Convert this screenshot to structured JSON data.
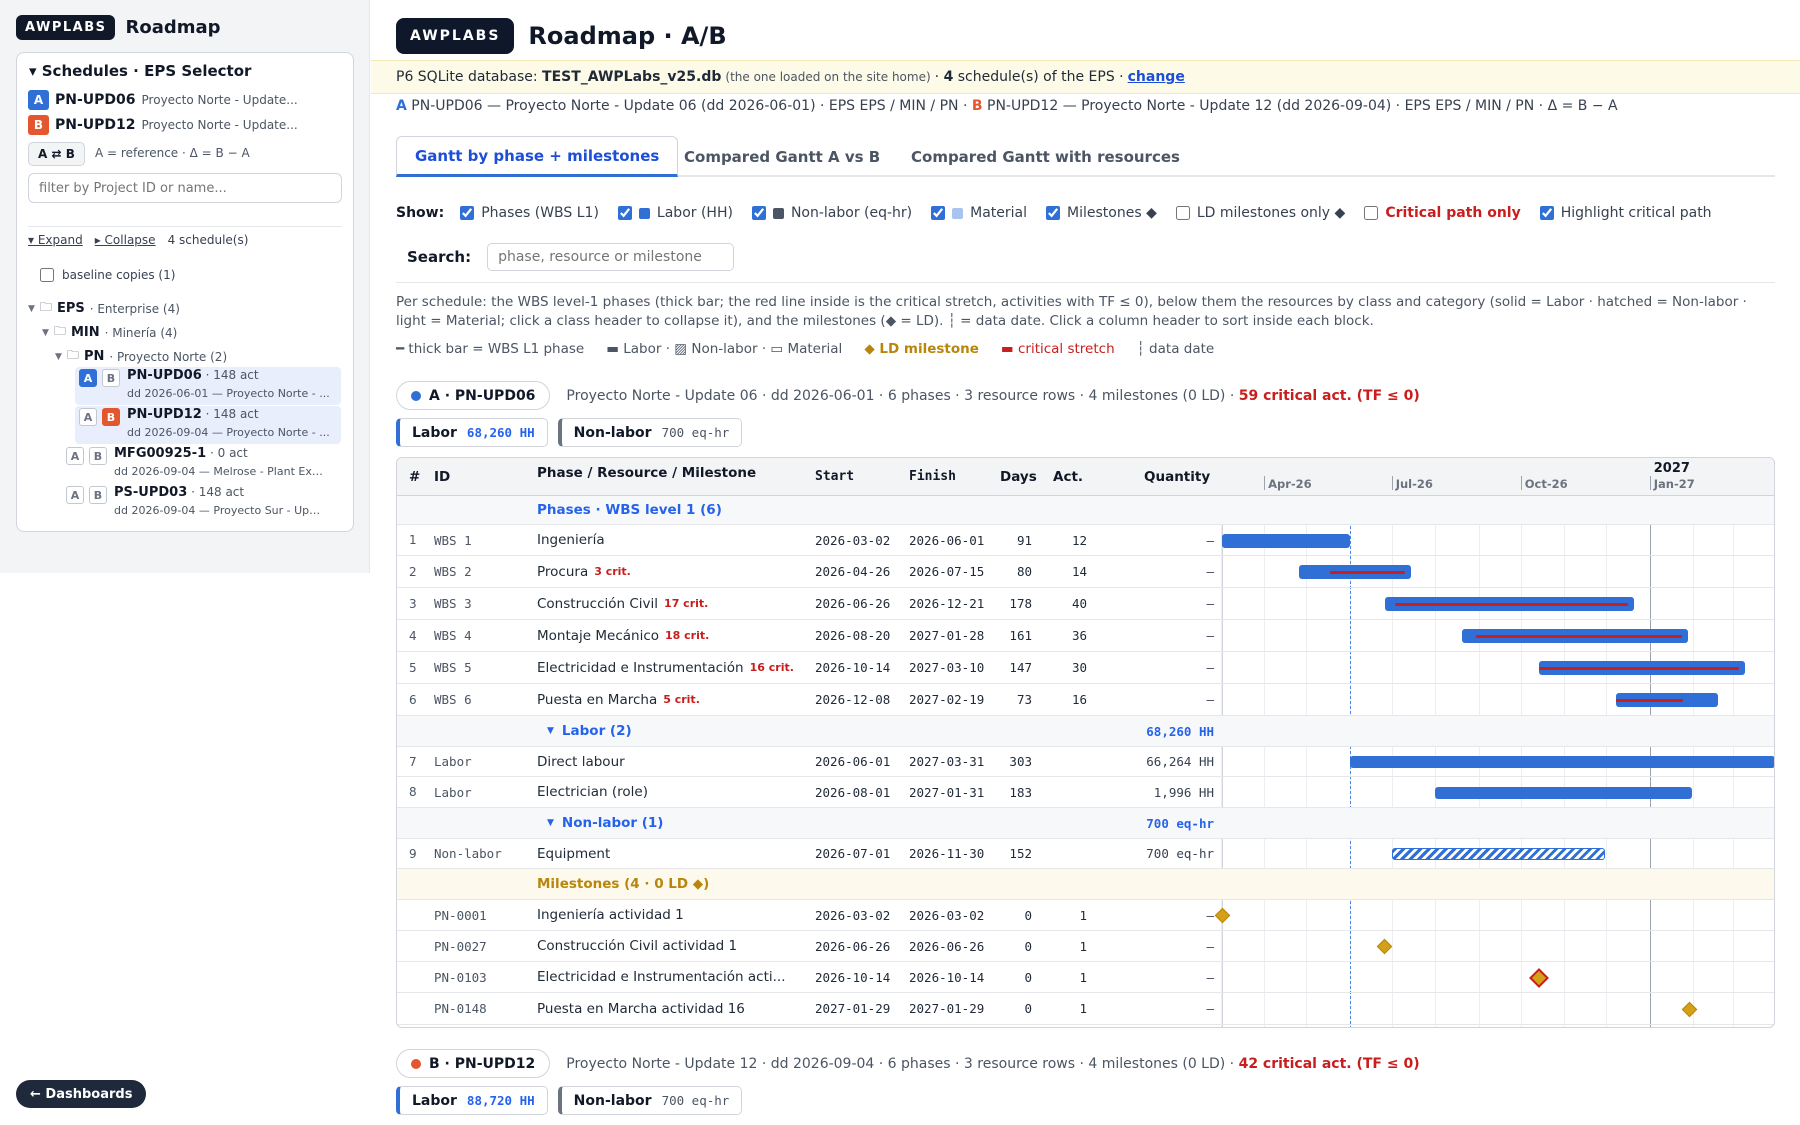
{
  "sidebar": {
    "brand_logo": "AWPLABS",
    "brand_title": "Roadmap",
    "panel_title": "▾ Schedules · EPS Selector",
    "schedule_a": {
      "badge": "A",
      "id": "PN-UPD06",
      "name": "Proyecto Norte - Update..."
    },
    "schedule_b": {
      "badge": "B",
      "id": "PN-UPD12",
      "name": "Proyecto Norte - Update..."
    },
    "swap_label": "A ⇄ B",
    "swap_note": "A = reference · Δ = B − A",
    "filter_placeholder": "filter by Project ID or name...",
    "expand_label": "▾ Expand",
    "collapse_label": "▸ Collapse",
    "schedule_count": "4 schedule(s)",
    "baseline_label": "baseline copies (1)",
    "tree": {
      "eps": {
        "name": "EPS",
        "desc": "· Enterprise (4)"
      },
      "min": {
        "name": "MIN",
        "desc": "· Minería (4)"
      },
      "pn": {
        "name": "PN",
        "desc": "· Proyecto Norte (2)"
      }
    },
    "leaves": [
      {
        "id": "PN-UPD06",
        "acts": "· 148 act",
        "sub": "dd 2026-06-01 — Proyecto Norte - ...",
        "a_label": "A",
        "b_label": "B"
      },
      {
        "id": "PN-UPD12",
        "acts": "· 148 act",
        "sub": "dd 2026-09-04 — Proyecto Norte - ...",
        "a_label": "A",
        "b_label": "B"
      },
      {
        "id": "MFG00925-1",
        "acts": "· 0 act",
        "sub": "dd 2026-09-04 — Melrose - Plant Expa...",
        "a_label": "A",
        "b_label": "B"
      },
      {
        "id": "PS-UPD03",
        "acts": "· 148 act",
        "sub": "dd 2026-09-04 — Proyecto Sur - Upda...",
        "a_label": "A",
        "b_label": "B"
      }
    ],
    "dashboards_label": "← Dashboards"
  },
  "header": {
    "logo": "AWPLABS",
    "title": "Roadmap · A/B"
  },
  "banner": {
    "prefix": "P6 SQLite database:",
    "db_name": "TEST_AWPLabs_v25.db",
    "note": "(the one loaded on the site home)",
    "count_pre": "·",
    "count": "4",
    "count_post": "schedule(s) of the EPS ·",
    "change_label": "change"
  },
  "ab_line": {
    "a_tag": "A",
    "a_text": "PN-UPD06 — Proyecto Norte - Update 06 (dd 2026-06-01) · EPS EPS / MIN / PN ·",
    "b_tag": "B",
    "b_text": "PN-UPD12 — Proyecto Norte - Update 12 (dd 2026-09-04) · EPS EPS / MIN / PN · Δ = B − A"
  },
  "tabs": [
    {
      "label": "Gantt by phase + milestones"
    },
    {
      "label": "Compared Gantt A vs B"
    },
    {
      "label": "Compared Gantt with resources"
    }
  ],
  "show": {
    "label": "Show:",
    "options": [
      {
        "label": "Phases (WBS L1)",
        "checked": true
      },
      {
        "label": "Labor (HH)",
        "checked": true
      },
      {
        "label": "Non-labor (eq-hr)",
        "checked": true
      },
      {
        "label": "Material",
        "checked": true
      },
      {
        "label": "Milestones ◆",
        "checked": true
      },
      {
        "label": "LD milestones only ◆",
        "checked": false
      },
      {
        "label": "Critical path only",
        "checked": false
      },
      {
        "label": "Highlight critical path",
        "checked": true
      }
    ]
  },
  "search": {
    "label": "Search:",
    "placeholder": "phase, resource or milestone"
  },
  "description": "Per schedule: the WBS level-1 phases (thick bar; the red line inside is the critical stretch, activities with TF ≤ 0), below them the resources by class and category (solid = Labor · hatched = Non-labor · light = Material; click a class header to collapse it), and the milestones (◆ = LD). ┆ = data date. Click a column header to sort inside each block.",
  "legend": {
    "phase": "━ thick bar = WBS L1 phase",
    "labor": "▬ Labor · ▨ Non-labor · ▭ Material",
    "ld": "◆ LD milestone",
    "crit": "▬ critical stretch",
    "dd": "┆ data date"
  },
  "schedule_a_block": {
    "pill": "A · PN-UPD06",
    "summary": "Proyecto Norte - Update 06 · dd 2026-06-01 · 6 phases · 3 resource rows · 4 milestones (0 LD) ·",
    "critical": "59 critical act. (TF ≤ 0)",
    "labor_card": {
      "label": "Labor",
      "value": "68,260 HH"
    },
    "nonlabor_card": {
      "label": "Non-labor",
      "value": "700 eq-hr"
    }
  },
  "schedule_b_block": {
    "pill": "B · PN-UPD12",
    "summary": "Proyecto Norte - Update 12 · dd 2026-09-04 · 6 phases · 3 resource rows · 4 milestones (0 LD) ·",
    "critical": "42 critical act. (TF ≤ 0)",
    "labor_card": {
      "label": "Labor",
      "value": "88,720 HH"
    },
    "nonlabor_card": {
      "label": "Non-labor",
      "value": "700 eq-hr"
    }
  },
  "grid": {
    "columns": {
      "num": "#",
      "id": "ID",
      "name": "Phase / Resource / Milestone",
      "start": "Start",
      "finish": "Finish",
      "days": "Days",
      "act": "Act.",
      "qty": "Quantity"
    },
    "timeline": {
      "year_label": "2027",
      "months": [
        "Apr-26",
        "Jul-26",
        "Oct-26",
        "Jan-27"
      ],
      "data_date": "2026-06-01",
      "range_start": "2026-03-02",
      "range_end": "2027-04-01"
    },
    "phases_header": "Phases · WBS level 1 (6)",
    "phases": [
      {
        "num": "1",
        "id": "WBS 1",
        "name": "Ingeniería",
        "crit": "",
        "start": "2026-03-02",
        "finish": "2026-06-01",
        "days": "91",
        "act": "12",
        "qty": "–",
        "crit_start": "",
        "crit_end": ""
      },
      {
        "num": "2",
        "id": "WBS 2",
        "name": "Procura",
        "crit": "3 crit.",
        "start": "2026-04-26",
        "finish": "2026-07-15",
        "days": "80",
        "act": "14",
        "qty": "–",
        "crit_start": "2026-05-18",
        "crit_end": "2026-07-15"
      },
      {
        "num": "3",
        "id": "WBS 3",
        "name": "Construcción Civil",
        "crit": "17 crit.",
        "start": "2026-06-26",
        "finish": "2026-12-21",
        "days": "178",
        "act": "40",
        "qty": "–",
        "crit_start": "2026-07-03",
        "crit_end": "2026-12-21"
      },
      {
        "num": "4",
        "id": "WBS 4",
        "name": "Montaje Mecánico",
        "crit": "18 crit.",
        "start": "2026-08-20",
        "finish": "2027-01-28",
        "days": "161",
        "act": "36",
        "qty": "–",
        "crit_start": "2026-08-30",
        "crit_end": "2027-01-28"
      },
      {
        "num": "5",
        "id": "WBS 5",
        "name": "Electricidad e Instrumentación",
        "crit": "16 crit.",
        "start": "2026-10-14",
        "finish": "2027-03-10",
        "days": "147",
        "act": "30",
        "qty": "–",
        "crit_start": "2026-10-14",
        "crit_end": "2027-03-10"
      },
      {
        "num": "6",
        "id": "WBS 6",
        "name": "Puesta en Marcha",
        "crit": "5 crit.",
        "start": "2026-12-08",
        "finish": "2027-02-19",
        "days": "73",
        "act": "16",
        "qty": "–",
        "crit_start": "2026-12-08",
        "crit_end": "2027-01-29"
      }
    ],
    "labor_header": {
      "label": "Labor (2)",
      "qty": "68,260 HH"
    },
    "labor": [
      {
        "num": "7",
        "id": "Labor",
        "name": "Direct labour",
        "start": "2026-06-01",
        "finish": "2027-03-31",
        "days": "303",
        "act": "",
        "qty": "66,264 HH"
      },
      {
        "num": "8",
        "id": "Labor",
        "name": "Electrician (role)",
        "start": "2026-08-01",
        "finish": "2027-01-31",
        "days": "183",
        "act": "",
        "qty": "1,996 HH"
      }
    ],
    "nonlabor_header": {
      "label": "Non-labor (1)",
      "qty": "700 eq-hr"
    },
    "nonlabor": [
      {
        "num": "9",
        "id": "Non-labor",
        "name": "Equipment",
        "start": "2026-07-01",
        "finish": "2026-11-30",
        "days": "152",
        "act": "",
        "qty": "700 eq-hr"
      }
    ],
    "milestones_header": "Milestones (4 · 0 LD ◆)",
    "milestones": [
      {
        "id": "PN-0001",
        "name": "Ingeniería actividad 1",
        "start": "2026-03-02",
        "finish": "2026-03-02",
        "days": "0",
        "act": "1",
        "qty": "–",
        "critical": false
      },
      {
        "id": "PN-0027",
        "name": "Construcción Civil actividad 1",
        "start": "2026-06-26",
        "finish": "2026-06-26",
        "days": "0",
        "act": "1",
        "qty": "–",
        "critical": false
      },
      {
        "id": "PN-0103",
        "name": "Electricidad e Instrumentación acti...",
        "start": "2026-10-14",
        "finish": "2026-10-14",
        "days": "0",
        "act": "1",
        "qty": "–",
        "critical": true
      },
      {
        "id": "PN-0148",
        "name": "Puesta en Marcha actividad 16",
        "start": "2027-01-29",
        "finish": "2027-01-29",
        "days": "0",
        "act": "1",
        "qty": "–",
        "critical": false
      }
    ]
  },
  "colors": {
    "accent": "#2f6fd6",
    "schedule_a": "#2f6fd6",
    "schedule_b": "#e4572e",
    "critical": "#c81e1e",
    "milestone": "#d4a017",
    "banner_bg": "#fdfbe8"
  }
}
